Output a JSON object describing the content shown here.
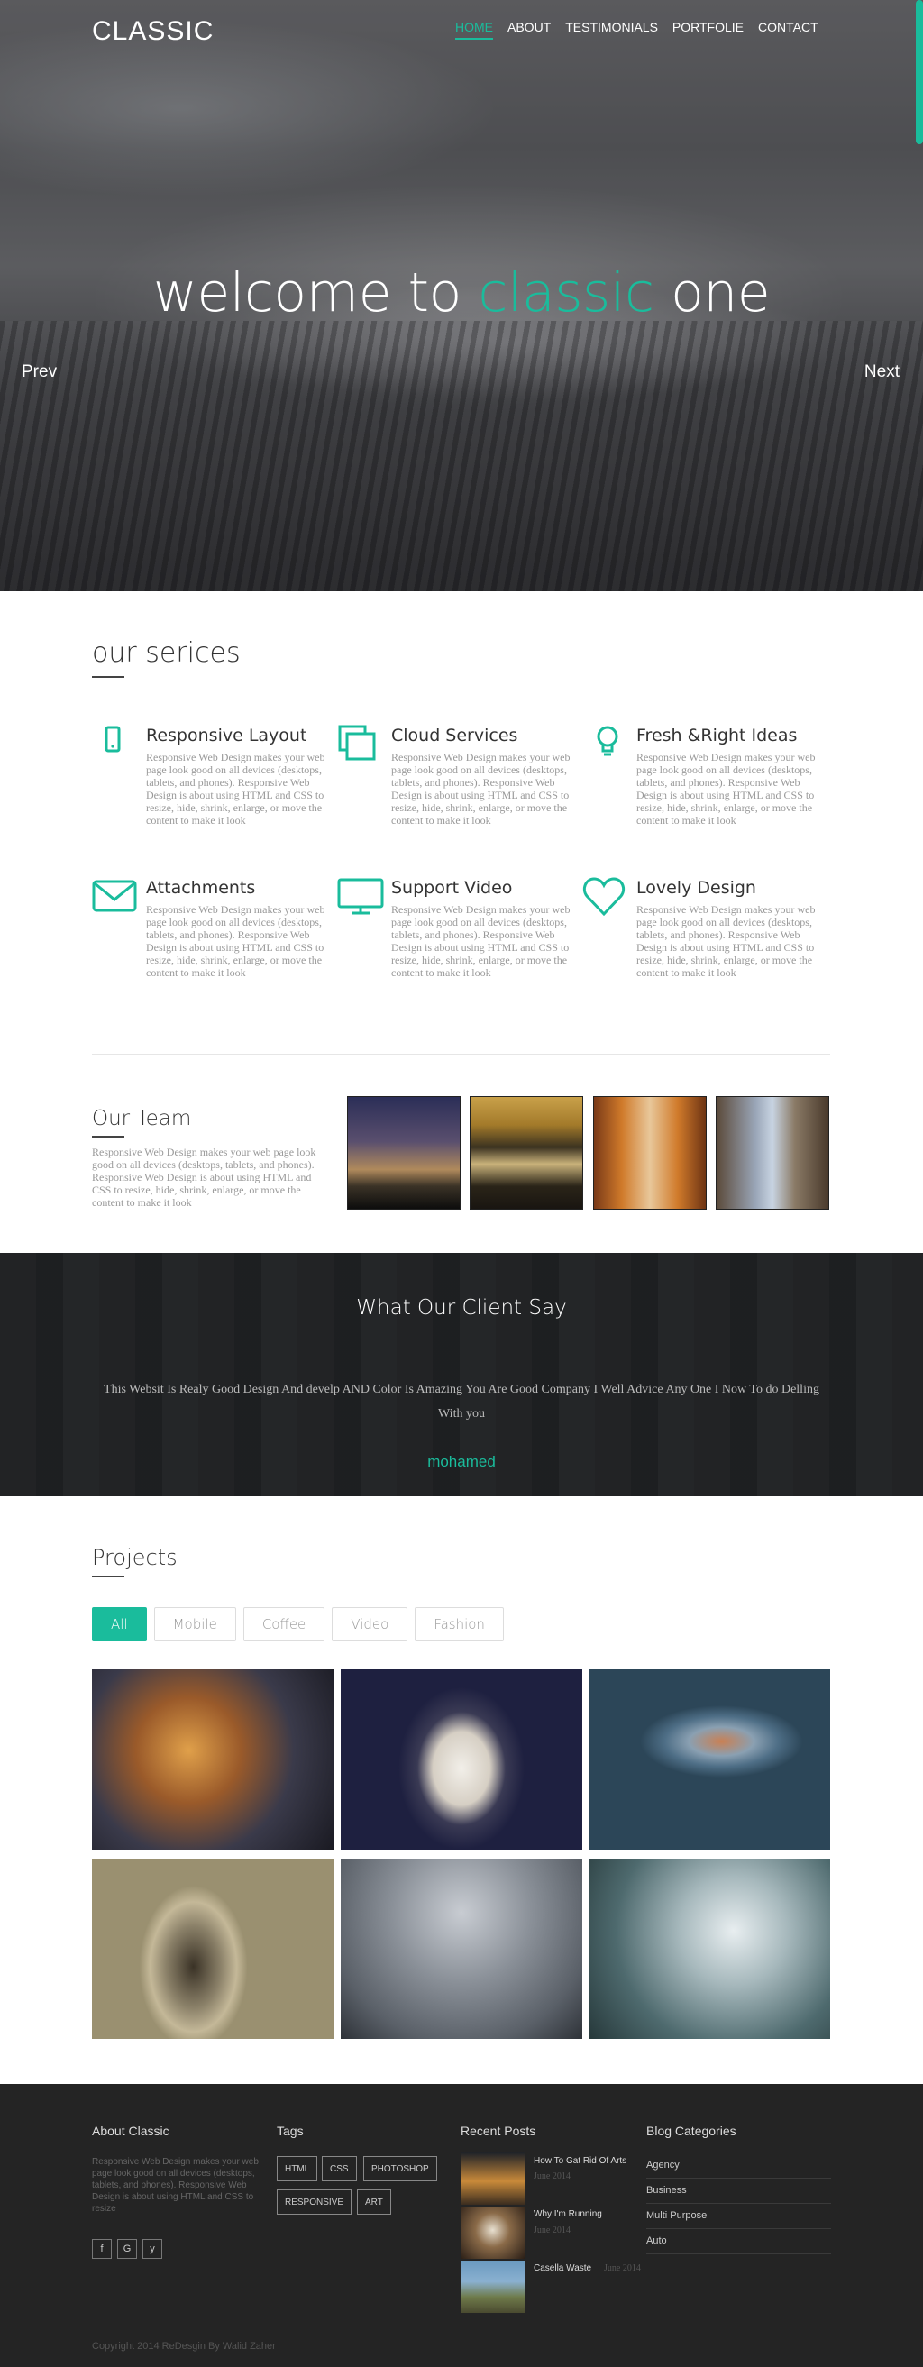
{
  "header": {
    "logo": "CLASSIC",
    "nav": [
      "HOME",
      "ABOUT",
      "TESTIMONIALS",
      "PORTFOLIE",
      "CONTACT"
    ],
    "active_nav": "HOME"
  },
  "hero": {
    "title_part1": "welcome to",
    "title_accent": "classic",
    "title_part2": "one",
    "prev": "Prev",
    "next": "Next"
  },
  "services": {
    "title": "our serices",
    "items": [
      {
        "title": "Responsive Layout",
        "icon": "mobile-icon",
        "text": "Responsive Web Design makes your web page look good on all devices (desktops, tablets, and phones). Responsive Web Design is about using HTML and CSS to resize, hide, shrink, enlarge, or move the content to make it look"
      },
      {
        "title": "Cloud Services",
        "icon": "copy-icon",
        "text": "Responsive Web Design makes your web page look good on all devices (desktops, tablets, and phones). Responsive Web Design is about using HTML and CSS to resize, hide, shrink, enlarge, or move the content to make it look"
      },
      {
        "title": "Fresh &Right Ideas",
        "icon": "lightbulb-icon",
        "text": "Responsive Web Design makes your web page look good on all devices (desktops, tablets, and phones). Responsive Web Design is about using HTML and CSS to resize, hide, shrink, enlarge, or move the content to make it look"
      },
      {
        "title": "Attachments",
        "icon": "envelope-icon",
        "text": "Responsive Web Design makes your web page look good on all devices (desktops, tablets, and phones). Responsive Web Design is about using HTML and CSS to resize, hide, shrink, enlarge, or move the content to make it look"
      },
      {
        "title": "Support Video",
        "icon": "monitor-icon",
        "text": "Responsive Web Design makes your web page look good on all devices (desktops, tablets, and phones). Responsive Web Design is about using HTML and CSS to resize, hide, shrink, enlarge, or move the content to make it look"
      },
      {
        "title": "Lovely Design",
        "icon": "heart-icon",
        "text": "Responsive Web Design makes your web page look good on all devices (desktops, tablets, and phones). Responsive Web Design is about using HTML and CSS to resize, hide, shrink, enlarge, or move the content to make it look"
      }
    ]
  },
  "team": {
    "title": "Our Team",
    "text": "Responsive Web Design makes your web page look good on all devices (desktops, tablets, and phones). Responsive Web Design is about using HTML and CSS to resize, hide, shrink, enlarge, or move the content to make it look"
  },
  "testimonial": {
    "title": "What Our Client Say",
    "quote": "This Websit Is Realy Good Design And develp AND Color Is Amazing You Are Good Company I Well Advice Any One I Now To do Delling With you",
    "name": "mohamed"
  },
  "projects": {
    "title": "Projects",
    "filters": [
      "All",
      "Mobile",
      "Coffee",
      "Video",
      "Fashion"
    ],
    "active_filter": "All"
  },
  "footer": {
    "about_title": "About Classic",
    "about_text": "Responsive Web Design makes your web page look good on all devices (desktops, tablets, and phones). Responsive Web Design is about using HTML and CSS to resize",
    "social": [
      "f",
      "G",
      "y"
    ],
    "tags_title": "Tags",
    "tags": [
      "HTML",
      "CSS",
      "PHOTOSHOP",
      "RESPONSIVE",
      "ART"
    ],
    "posts_title": "Recent Posts",
    "posts": [
      {
        "title": "How To Gat Rid Of Arts",
        "date": "June 2014"
      },
      {
        "title": "Why I'm Running",
        "date": "June 2014"
      },
      {
        "title": "Casella Waste",
        "date": "June 2014"
      }
    ],
    "categories_title": "Blog Categories",
    "categories": [
      "Agency",
      "Business",
      "Multi Purpose",
      "Auto"
    ],
    "copyright": "Copyright 2014 ReDesgin By Walid Zaher"
  },
  "colors": {
    "accent": "#1abc9c",
    "footer_bg": "#242424",
    "text_muted": "#999999"
  }
}
